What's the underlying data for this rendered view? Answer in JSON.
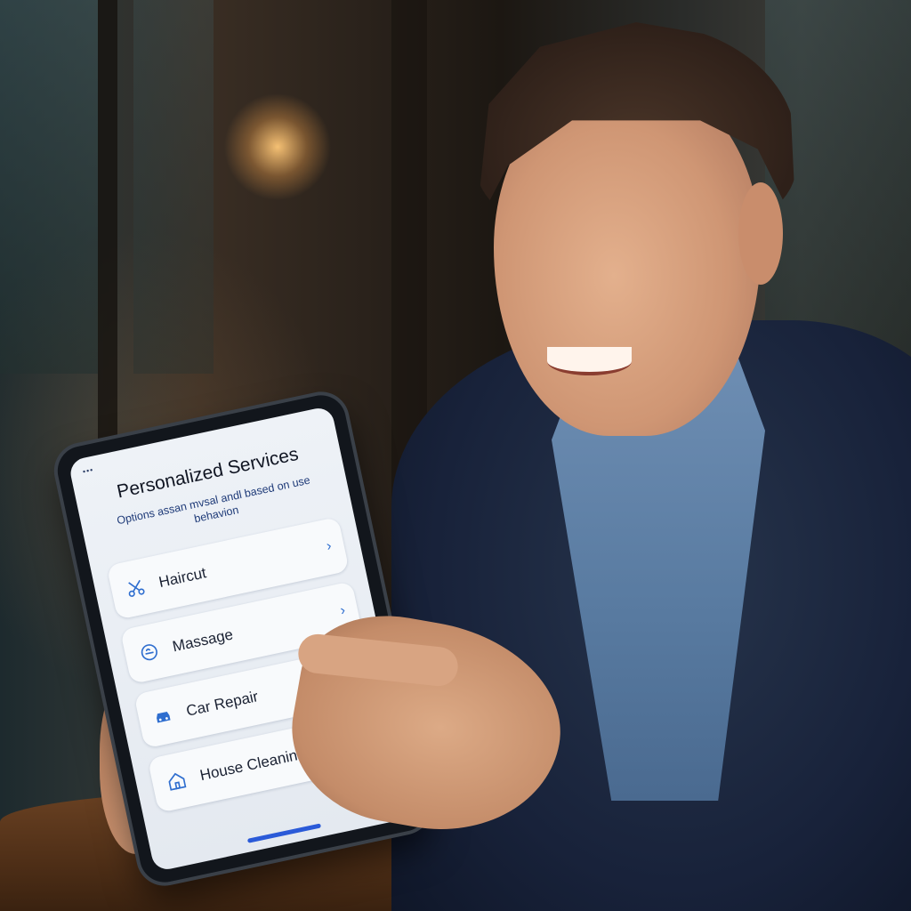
{
  "screen": {
    "status_indicator": "•••",
    "title": "Personalized Services",
    "subtitle": "Options assan mvsal andl based on use behavion",
    "services": [
      {
        "label": "Haircut",
        "icon": "scissors-icon",
        "chevron": "›"
      },
      {
        "label": "Massage",
        "icon": "massage-icon",
        "chevron": "›"
      },
      {
        "label": "Car Repair",
        "icon": "car-icon",
        "chevron": ""
      },
      {
        "label": "House Cleaning",
        "icon": "house-icon",
        "chevron": ""
      }
    ]
  },
  "colors": {
    "accent": "#2f6ecf",
    "screen_background": "#eef2f7",
    "title_text": "#101522",
    "subtitle_text": "#1e3a78",
    "home_indicator": "#2a5ad8"
  }
}
